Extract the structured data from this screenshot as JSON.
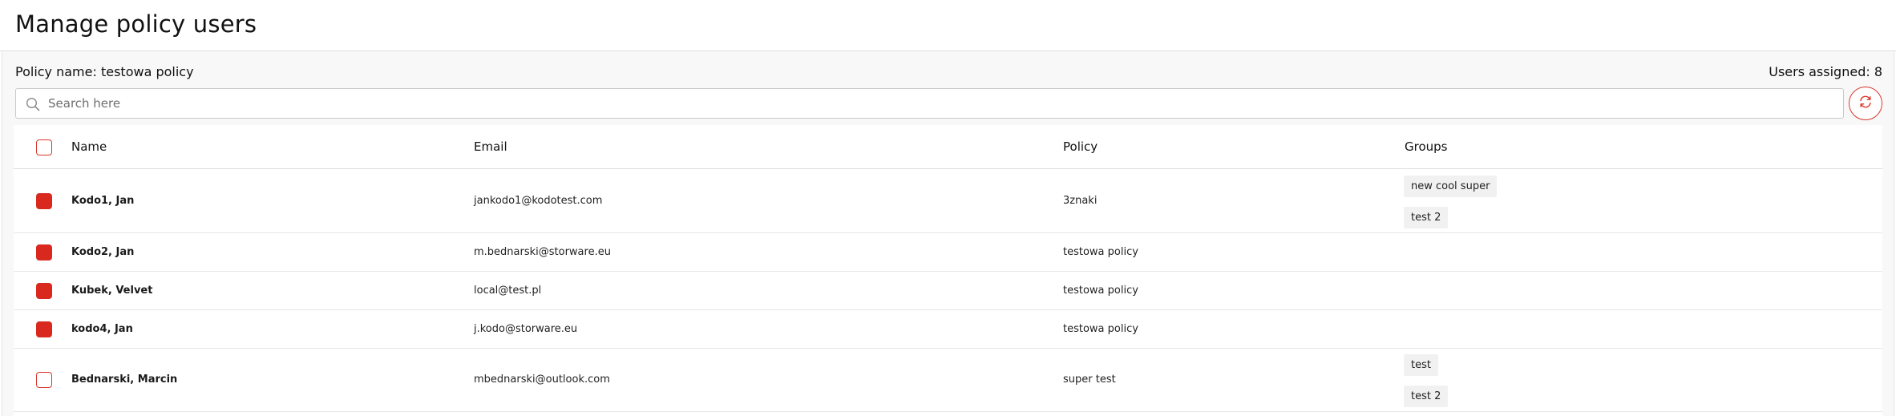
{
  "page": {
    "title": "Manage policy users"
  },
  "info": {
    "policy_name": "Policy name: testowa policy",
    "users_assigned": "Users assigned: 8"
  },
  "search": {
    "placeholder": "Search here"
  },
  "accent_color": "#d9291e",
  "icons": {
    "search": "search-icon",
    "refresh": "refresh-icon"
  },
  "table": {
    "headers": {
      "name": "Name",
      "email": "Email",
      "policy": "Policy",
      "groups": "Groups"
    },
    "rows": [
      {
        "checked": true,
        "name": "Kodo1, Jan",
        "email": "jankodo1@kodotest.com",
        "policy": "3znaki",
        "groups": [
          "new cool super",
          "test 2"
        ]
      },
      {
        "checked": true,
        "name": "Kodo2, Jan",
        "email": "m.bednarski@storware.eu",
        "policy": "testowa policy",
        "groups": []
      },
      {
        "checked": true,
        "name": "Kubek, Velvet",
        "email": "local@test.pl",
        "policy": "testowa policy",
        "groups": []
      },
      {
        "checked": true,
        "name": "kodo4, Jan",
        "email": "j.kodo@storware.eu",
        "policy": "testowa policy",
        "groups": []
      },
      {
        "checked": false,
        "name": "Bednarski, Marcin",
        "email": "mbednarski@outlook.com",
        "policy": "super test",
        "groups": [
          "test",
          "test 2"
        ]
      }
    ]
  }
}
